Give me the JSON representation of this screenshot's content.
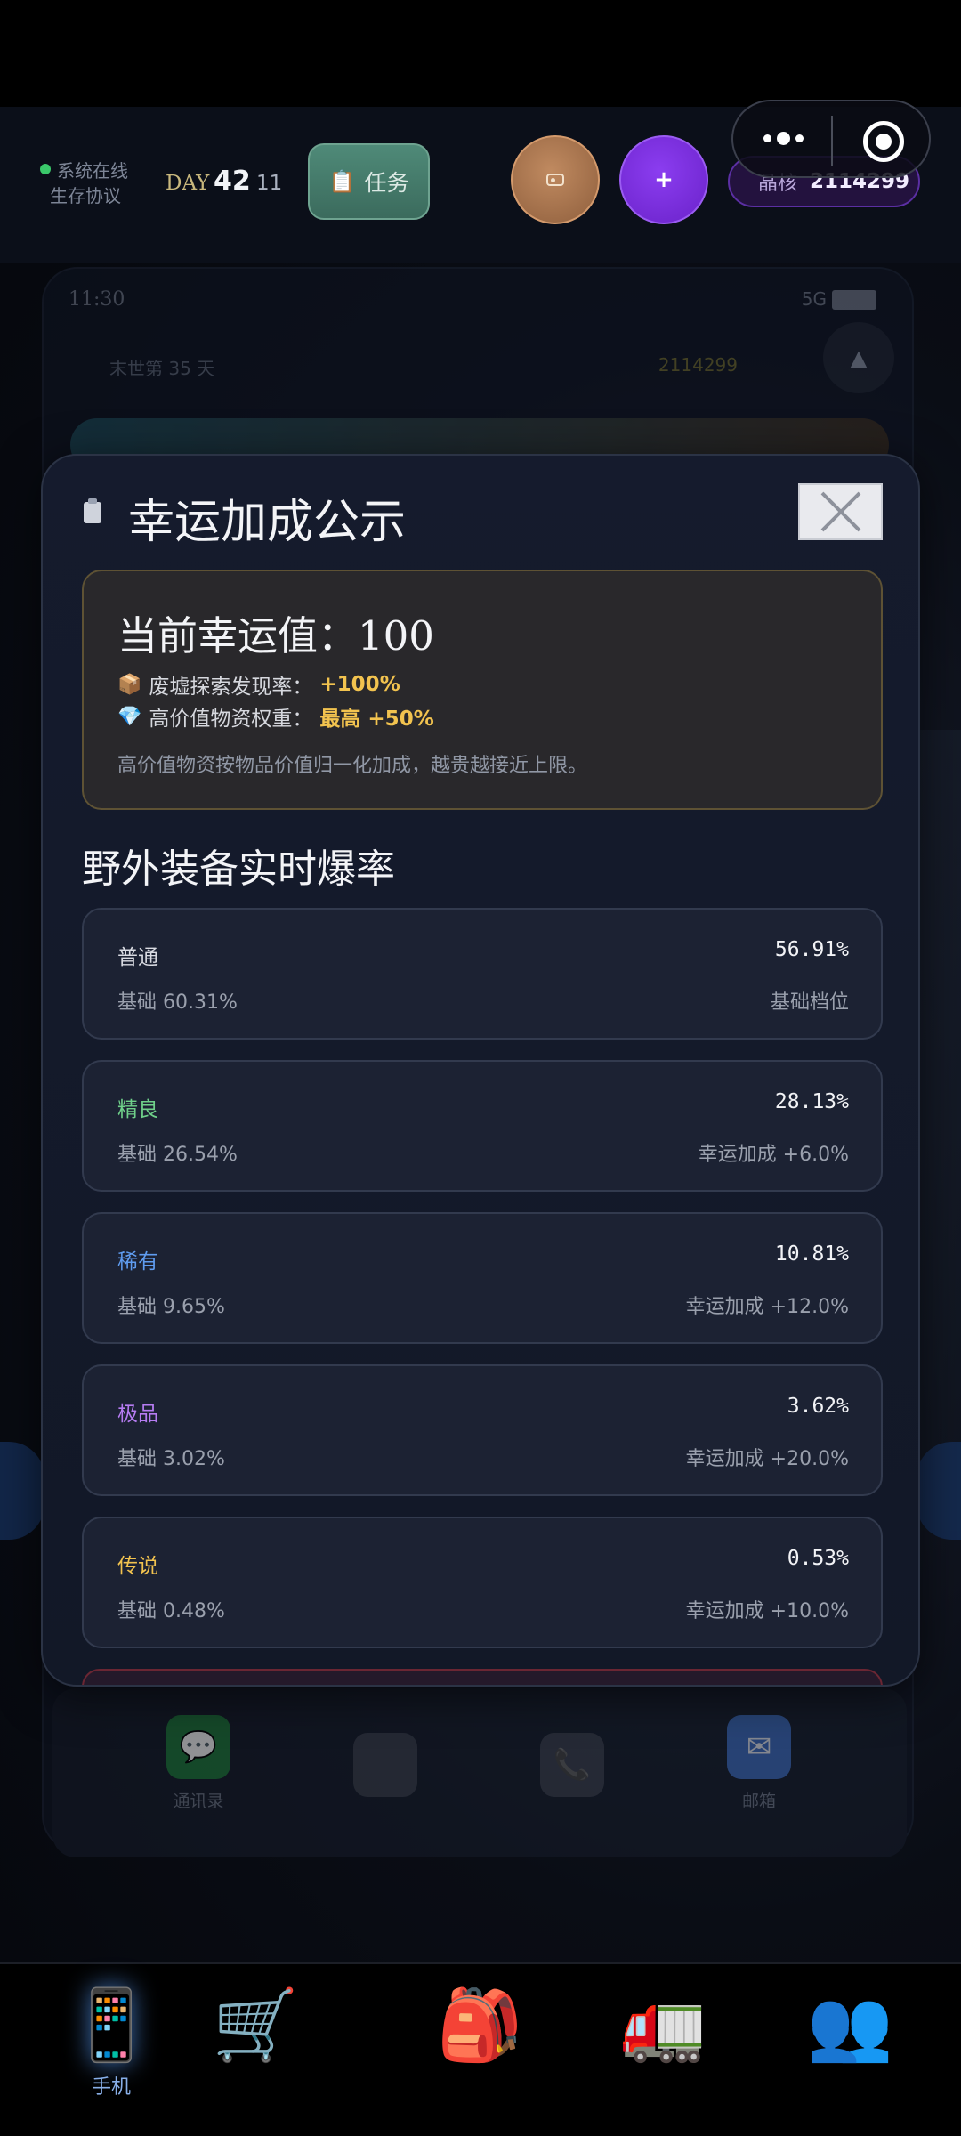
{
  "hud": {
    "online_text": "系统在线",
    "protocol_text": "生存协议",
    "day_label": "DAY",
    "day_number": "42",
    "day_sub": "11",
    "task_icon": "clipboard-icon",
    "task_label": "任务",
    "radio_icon": "radio-icon",
    "plus_label": "+",
    "crystal_label": "晶核",
    "crystal_value": "2114299"
  },
  "phone": {
    "time": "11:30",
    "network": "5G",
    "calendar_text": "末世第 35 天",
    "gem_value": "2114299",
    "up_arrow": "▲",
    "dock": [
      {
        "label": "通讯录",
        "icon": "chat-icon"
      },
      {
        "label": "",
        "icon": "blank-app-icon"
      },
      {
        "label": "",
        "icon": "phone-icon"
      },
      {
        "label": "邮箱",
        "icon": "mail-icon"
      }
    ]
  },
  "modal": {
    "title": "幸运加成公示",
    "close_icon": "close-icon",
    "luck": {
      "title": "当前幸运值：100",
      "line1_icon": "box-icon",
      "line1_label": "废墟探索发现率：",
      "line1_value": "+100%",
      "line2_icon": "gem-icon",
      "line2_label": "高价值物资权重：",
      "line2_value": "最高 +50%",
      "note": "高价值物资按物品价值归一化加成，越贵越接近上限。"
    },
    "section_title": "野外装备实时爆率",
    "rates": [
      {
        "tier": "普通",
        "rate": "56.91%",
        "base": "基础 60.31%",
        "bonus": "基础档位",
        "color": "#d9dbe2"
      },
      {
        "tier": "精良",
        "rate": "28.13%",
        "base": "基础 26.54%",
        "bonus": "幸运加成 +6.0%",
        "color": "#6fd08a"
      },
      {
        "tier": "稀有",
        "rate": "10.81%",
        "base": "基础 9.65%",
        "bonus": "幸运加成 +12.0%",
        "color": "#5f9cf0"
      },
      {
        "tier": "极品",
        "rate": "3.62%",
        "base": "基础 3.02%",
        "bonus": "幸运加成 +20.0%",
        "color": "#b67cf2"
      },
      {
        "tier": "传说",
        "rate": "0.53%",
        "base": "基础 0.48%",
        "bonus": "幸运加成 +10.0%",
        "color": "#f2c34f"
      }
    ]
  },
  "nav": {
    "items": [
      {
        "label": "手机",
        "icon": "mobile-phone-icon",
        "glyph": "📱",
        "active": true
      },
      {
        "label": "",
        "icon": "shopping-cart-icon",
        "glyph": "🛒",
        "active": false
      },
      {
        "label": "",
        "icon": "backpack-icon",
        "glyph": "🎒",
        "active": false
      },
      {
        "label": "",
        "icon": "truck-icon",
        "glyph": "🚛",
        "active": false
      },
      {
        "label": "",
        "icon": "people-icon",
        "glyph": "👥",
        "active": false
      }
    ]
  }
}
